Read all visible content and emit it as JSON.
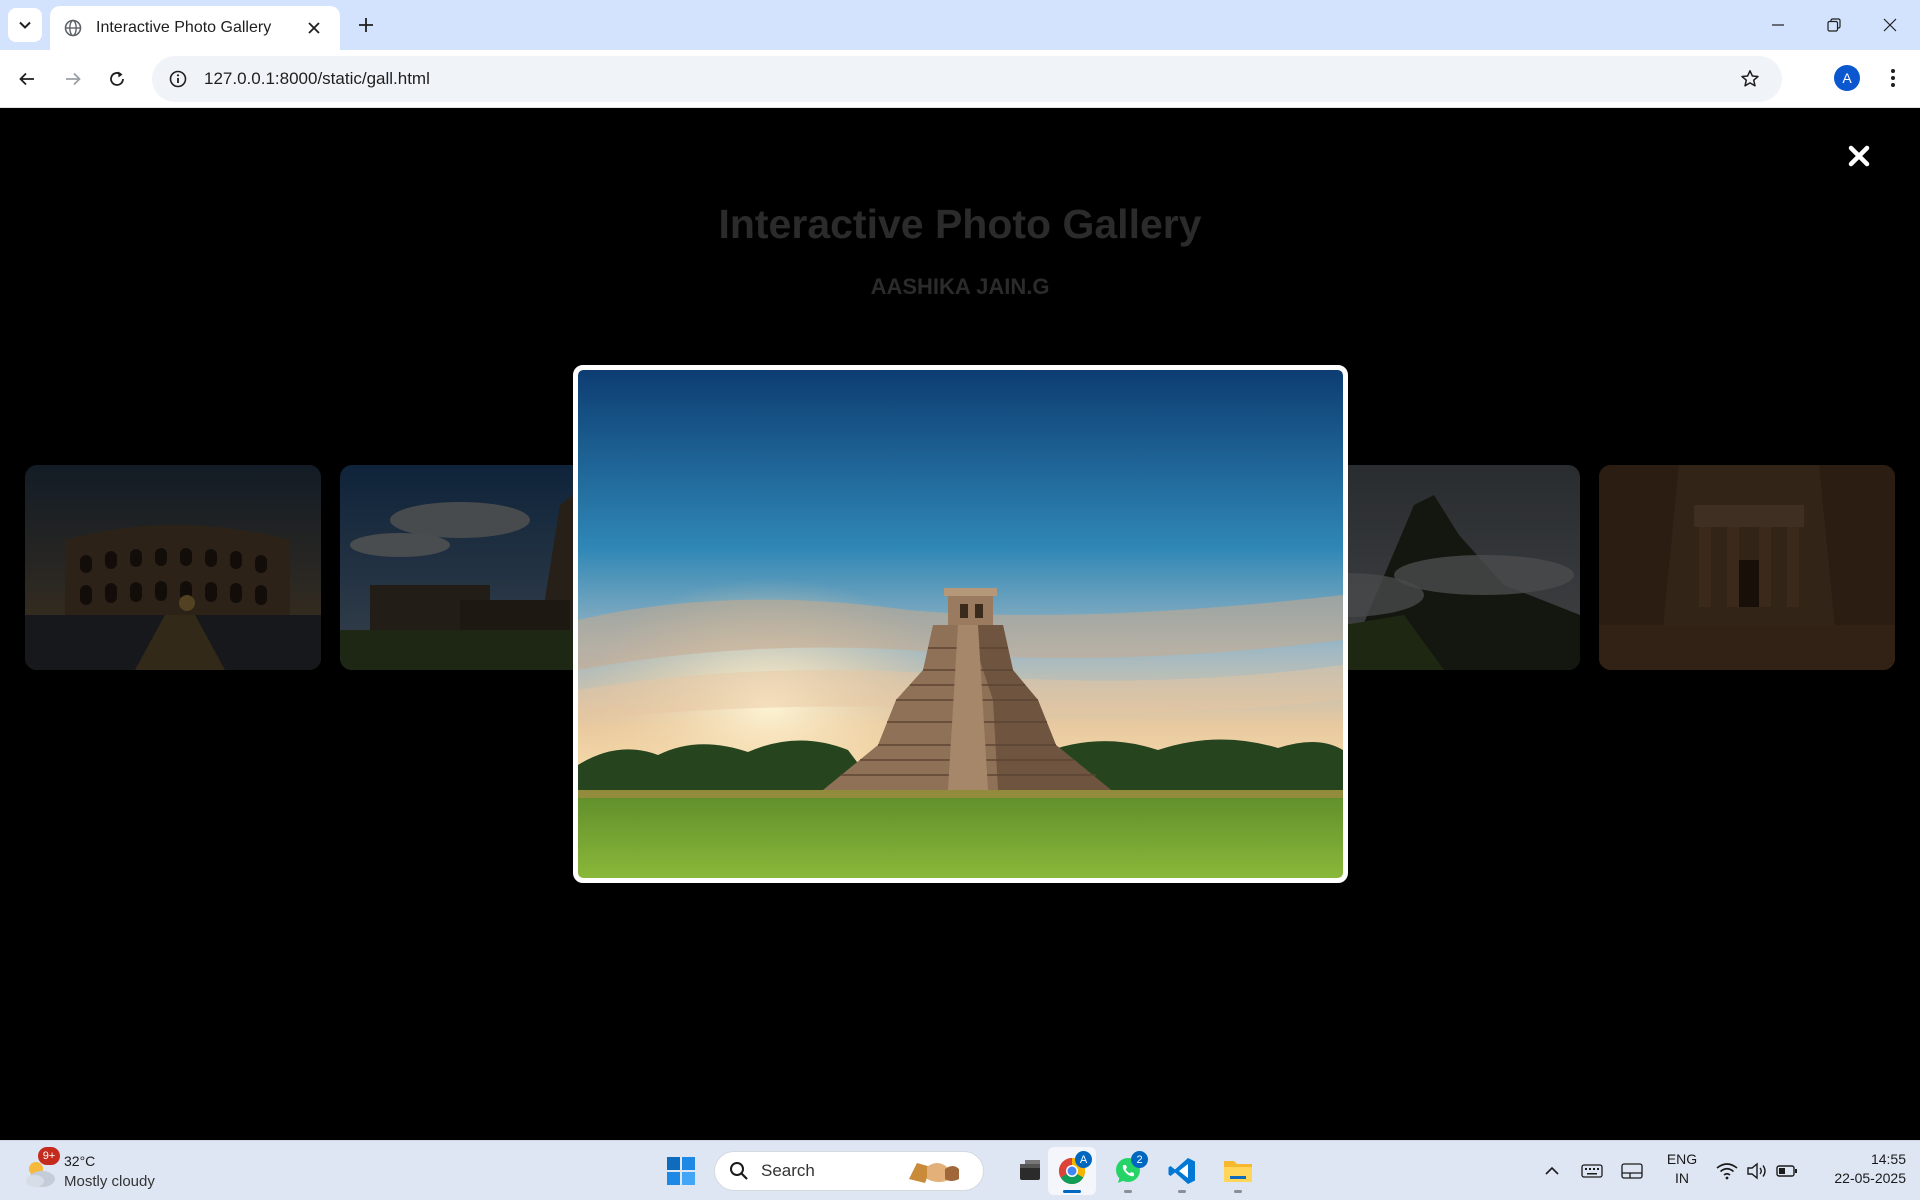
{
  "browser": {
    "tab_title": "Interactive Photo Gallery",
    "url": "127.0.0.1:8000/static/gall.html",
    "profile_initial": "A"
  },
  "page": {
    "title": "Interactive Photo Gallery",
    "subtitle": "AASHIKA JAIN.G"
  },
  "gallery": {
    "thumbnails": [
      "colosseum",
      "brihadeeswarar-temple",
      "machu-picchu",
      "petra-treasury"
    ],
    "lightbox_image": "chichen-itza-pyramid",
    "close_icon": "close-icon"
  },
  "taskbar": {
    "weather_temp": "32°C",
    "weather_desc": "Mostly cloudy",
    "weather_badge": "9+",
    "search_label": "Search",
    "whatsapp_badge": "2",
    "chrome_badge": "A",
    "lang_line1": "ENG",
    "lang_line2": "IN",
    "time": "14:55",
    "date": "22-05-2025"
  },
  "colors": {
    "tabstrip": "#d3e3fd",
    "page_background": "#000000",
    "taskbar": "#dfe6f3",
    "accent": "#0067c0"
  }
}
